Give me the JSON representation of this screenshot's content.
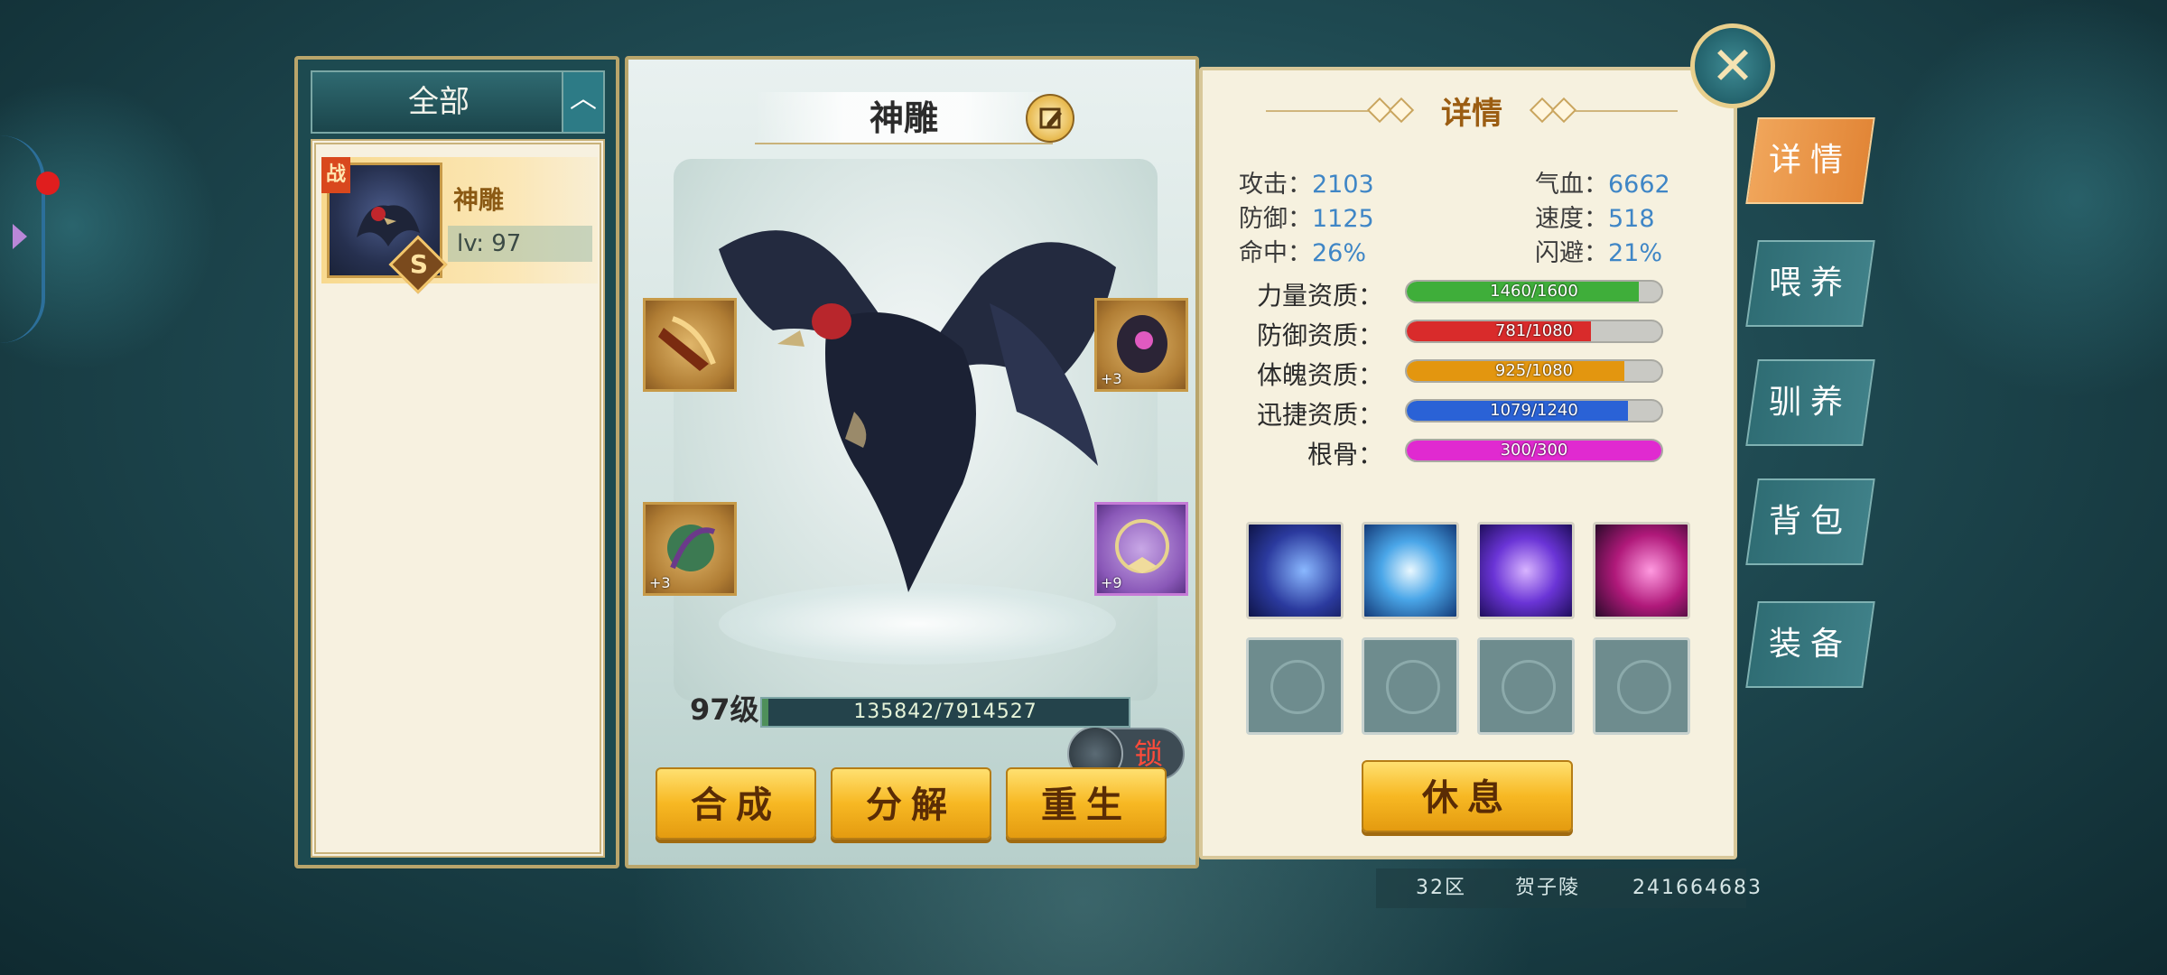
{
  "list": {
    "filter_label": "全部",
    "collapse_icon": "chevron-up-icon",
    "pets": [
      {
        "badge": "战",
        "grade": "S",
        "name": "神雕",
        "level": "lv: 97"
      }
    ]
  },
  "pet": {
    "name": "神雕",
    "equipment": [
      {
        "slot": "top-left",
        "plus": ""
      },
      {
        "slot": "top-right",
        "plus": "+3"
      },
      {
        "slot": "bottom-left",
        "plus": "+3"
      },
      {
        "slot": "bottom-right",
        "plus": "+9"
      }
    ],
    "lock_label": "锁",
    "level_label": "97级",
    "exp_text": "135842/7914527",
    "exp_fraction": 0.017,
    "actions": [
      "合成",
      "分解",
      "重生"
    ]
  },
  "detail": {
    "title": "详情",
    "stats": [
      {
        "label": "攻击：",
        "value": "2103"
      },
      {
        "label": "气血：",
        "value": "6662"
      },
      {
        "label": "防御：",
        "value": "1125"
      },
      {
        "label": "速度：",
        "value": "518"
      },
      {
        "label": "命中：",
        "value": "26%"
      },
      {
        "label": "闪避：",
        "value": "21%"
      }
    ],
    "aptitudes": [
      {
        "label": "力量资质：",
        "text": "1460/1600",
        "fraction": 0.9125,
        "color": "#3fae3a"
      },
      {
        "label": "防御资质：",
        "text": "781/1080",
        "fraction": 0.723,
        "color": "#d92b2b"
      },
      {
        "label": "体魄资质：",
        "text": "925/1080",
        "fraction": 0.856,
        "color": "#e3960f"
      },
      {
        "label": "迅捷资质：",
        "text": "1079/1240",
        "fraction": 0.87,
        "color": "#2a62d6"
      },
      {
        "label": "根骨：",
        "text": "300/300",
        "fraction": 1.0,
        "color": "#e02ad0"
      }
    ],
    "skills": [
      "claw-slash-icon",
      "lightning-icon",
      "vortex-icon",
      "crimson-claw-icon"
    ],
    "empty_skill_slots": 4,
    "rest_button": "休息"
  },
  "tabs": [
    "详情",
    "喂养",
    "驯养",
    "背包",
    "装备"
  ],
  "footer": {
    "server": "32区",
    "player": "贺子陵",
    "id": "241664683"
  }
}
